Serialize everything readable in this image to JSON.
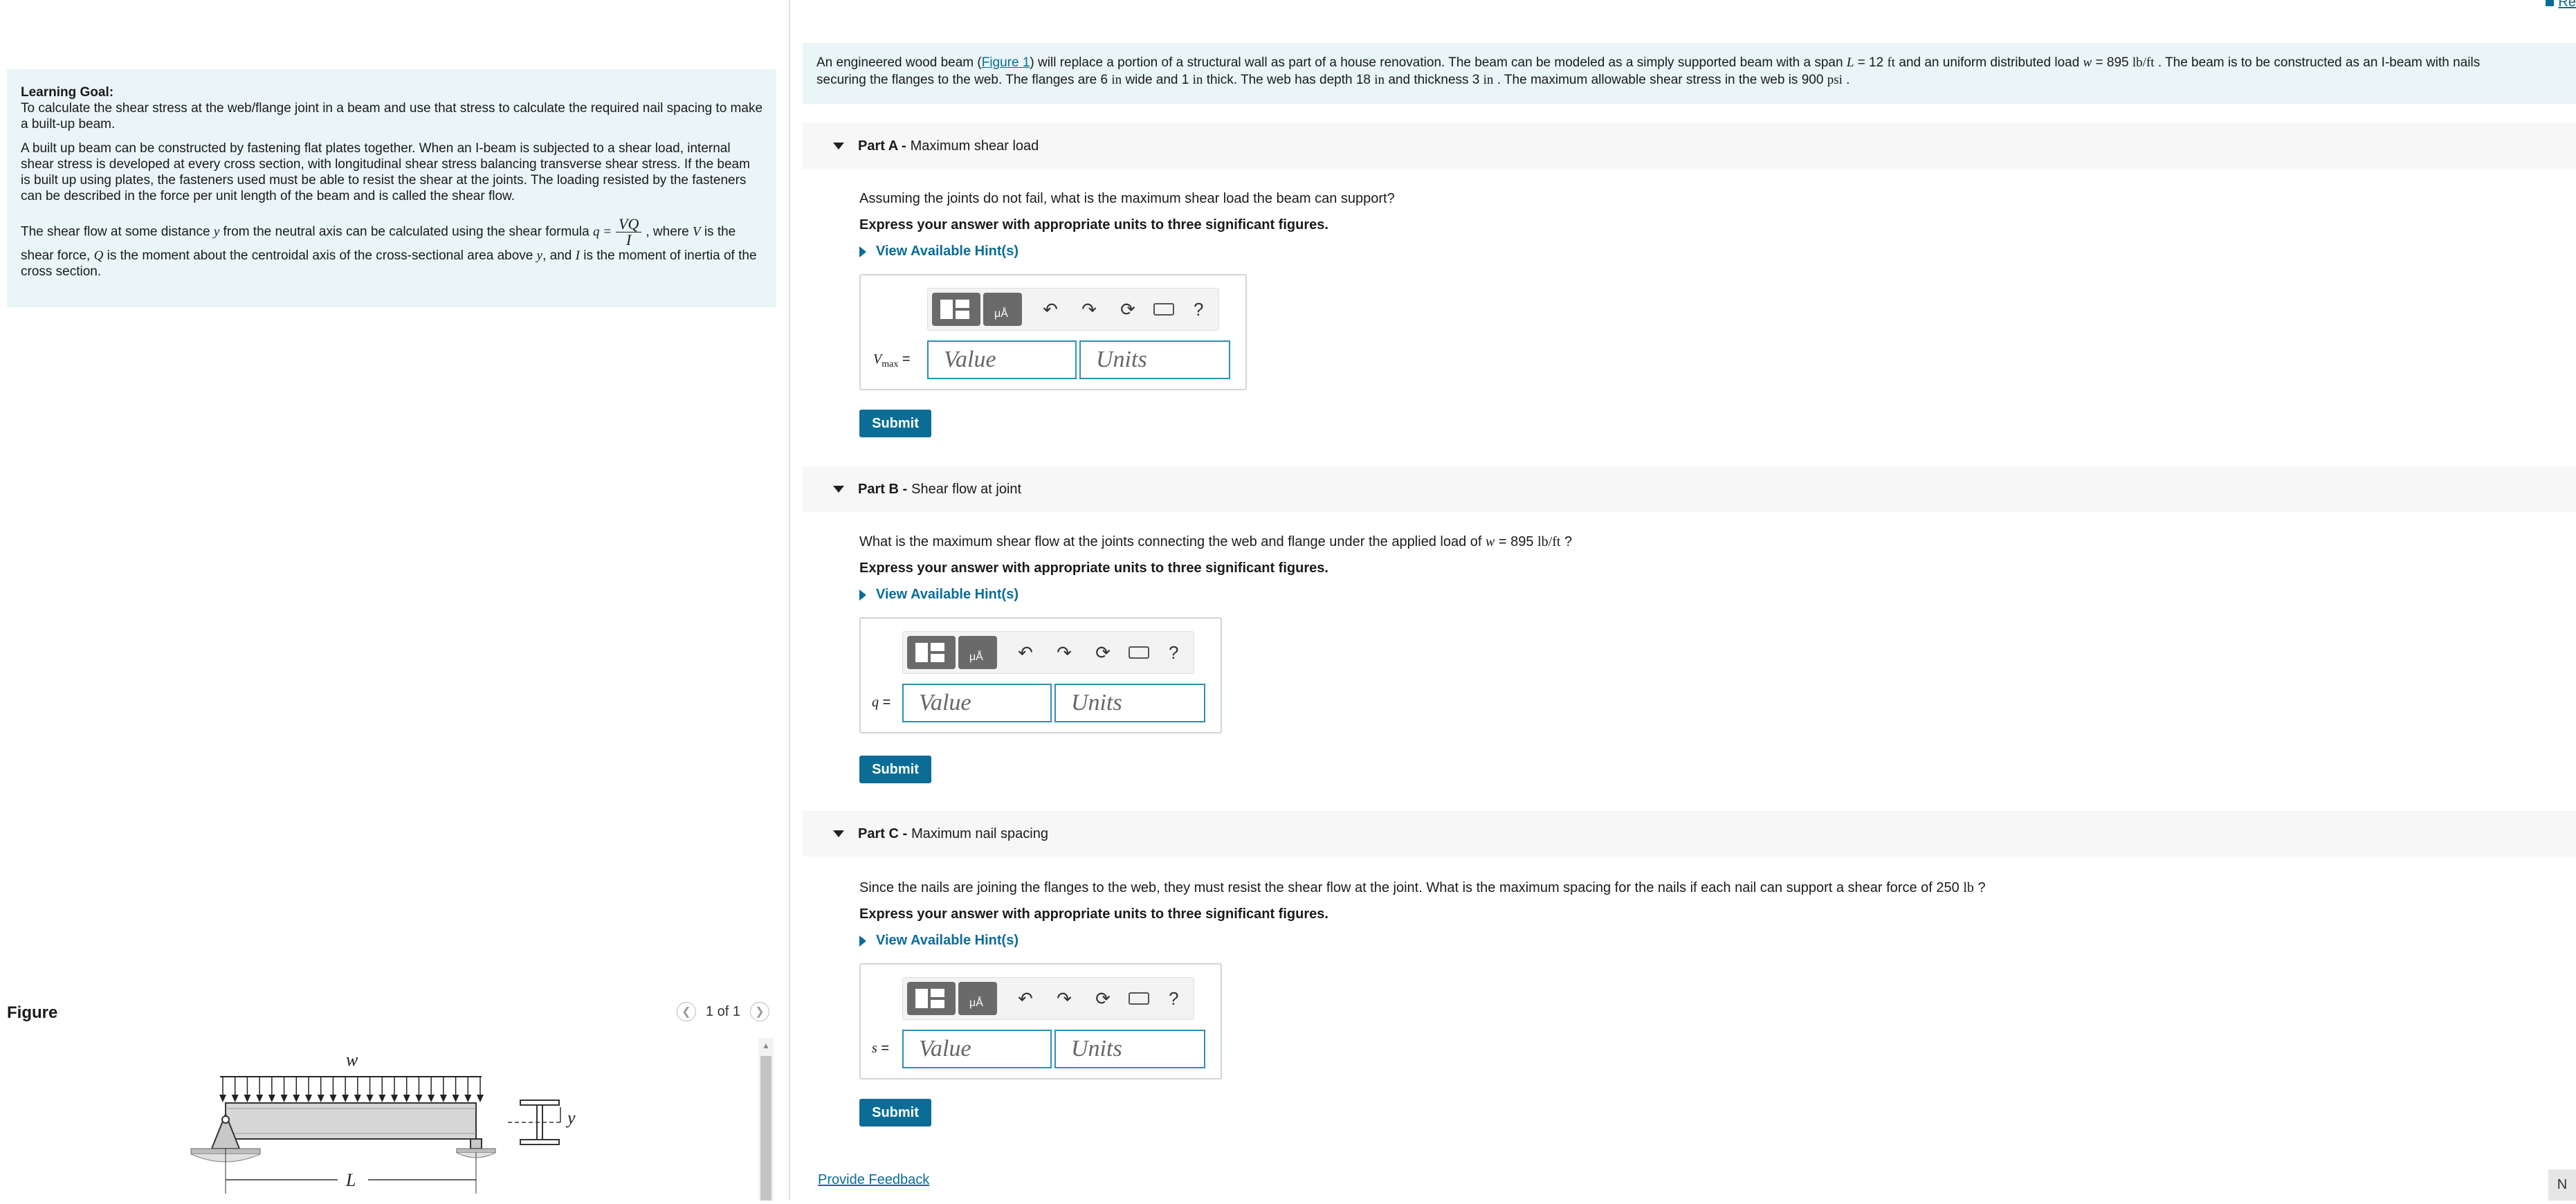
{
  "learning_goal": {
    "title": "Learning Goal:",
    "text": "To calculate the shear stress at the web/flange joint in a beam and use that stress to calculate the required nail spacing to make a built-up beam.",
    "para1": "A built up beam can be constructed by fastening flat plates together. When an I-beam is subjected to a shear load, internal shear stress is developed at every cross section, with longitudinal shear stress balancing transverse shear stress. If the beam is built up using plates, the fasteners used must be able to resist the shear at the joints. The loading resisted by the fasteners can be described in the force per unit length of the beam and is called the shear flow.",
    "para2_a": "The shear flow at some distance",
    "para2_y": "y",
    "para2_b": "from the neutral axis can be calculated using the shear formula",
    "formula_lhs": "q =",
    "formula_num": "VQ",
    "formula_den": "I",
    "para2_c": ", where",
    "para2_V": "V",
    "para2_d": "is the shear force,",
    "para2_Q": "Q",
    "para2_e": "is the moment about the centroidal axis of the cross-sectional area above",
    "para2_y2": "y",
    "para2_f": ", and",
    "para2_I": "I",
    "para2_g": "is the moment of inertia of the cross section."
  },
  "figure": {
    "title": "Figure",
    "pager": "1 of 1",
    "labels": {
      "w": "w",
      "L": "L",
      "y": "y"
    }
  },
  "top_link": "Re",
  "intro": {
    "a": "An engineered wood beam (",
    "link": "Figure 1",
    "b": ") will replace a portion of a structural wall as part of a house renovation. The beam can be modeled as a simply supported beam with a span",
    "L": "L",
    "c": "= 12",
    "ft": "ft",
    "d": "and an uniform distributed load",
    "w": "w",
    "e": "= 895",
    "lbft": "lb/ft",
    "f": ". The beam is to be constructed as an I-beam with nails",
    "line2_a": "securing the flanges to the web. The flanges are 6",
    "in1": "in",
    "line2_b": "wide and 1",
    "in2": "in",
    "line2_c": "thick. The web has depth 18",
    "in3": "in",
    "line2_d": "and thickness 3",
    "in4": "in",
    "line2_e": ". The maximum allowable shear stress in the web is 900",
    "psi": "psi",
    "line2_f": "."
  },
  "parts": [
    {
      "label": "Part A -",
      "title": "Maximum shear load",
      "question": "Assuming the joints do not fail, what is the maximum shear load the beam can support?",
      "express": "Express your answer with appropriate units to three significant figures.",
      "hint": "View Available Hint(s)",
      "var_main": "V",
      "var_sub": "max",
      "var_eq": "=",
      "value_placeholder": "Value",
      "units_placeholder": "Units",
      "submit": "Submit"
    },
    {
      "label": "Part B -",
      "title": "Shear flow at joint",
      "question_a": "What is the maximum shear flow at the joints connecting the web and flange under the applied load of",
      "question_w": "w",
      "question_b": "= 895",
      "question_unit": "lb/ft",
      "question_c": "?",
      "express": "Express your answer with appropriate units to three significant figures.",
      "hint": "View Available Hint(s)",
      "var_main": "q",
      "var_eq": "=",
      "value_placeholder": "Value",
      "units_placeholder": "Units",
      "submit": "Submit"
    },
    {
      "label": "Part C -",
      "title": "Maximum nail spacing",
      "question_a": "Since the nails are joining the flanges to the web, they must resist the shear flow at the joint. What is the maximum spacing for the nails if each nail can support a shear force of 250",
      "question_unit": "lb",
      "question_c": "?",
      "express": "Express your answer with appropriate units to three significant figures.",
      "hint": "View Available Hint(s)",
      "var_main": "s",
      "var_eq": "=",
      "value_placeholder": "Value",
      "units_placeholder": "Units",
      "submit": "Submit"
    }
  ],
  "toolbar": {
    "units_glyph": "μÅ",
    "help": "?"
  },
  "feedback": "Provide Feedback",
  "next": "N"
}
